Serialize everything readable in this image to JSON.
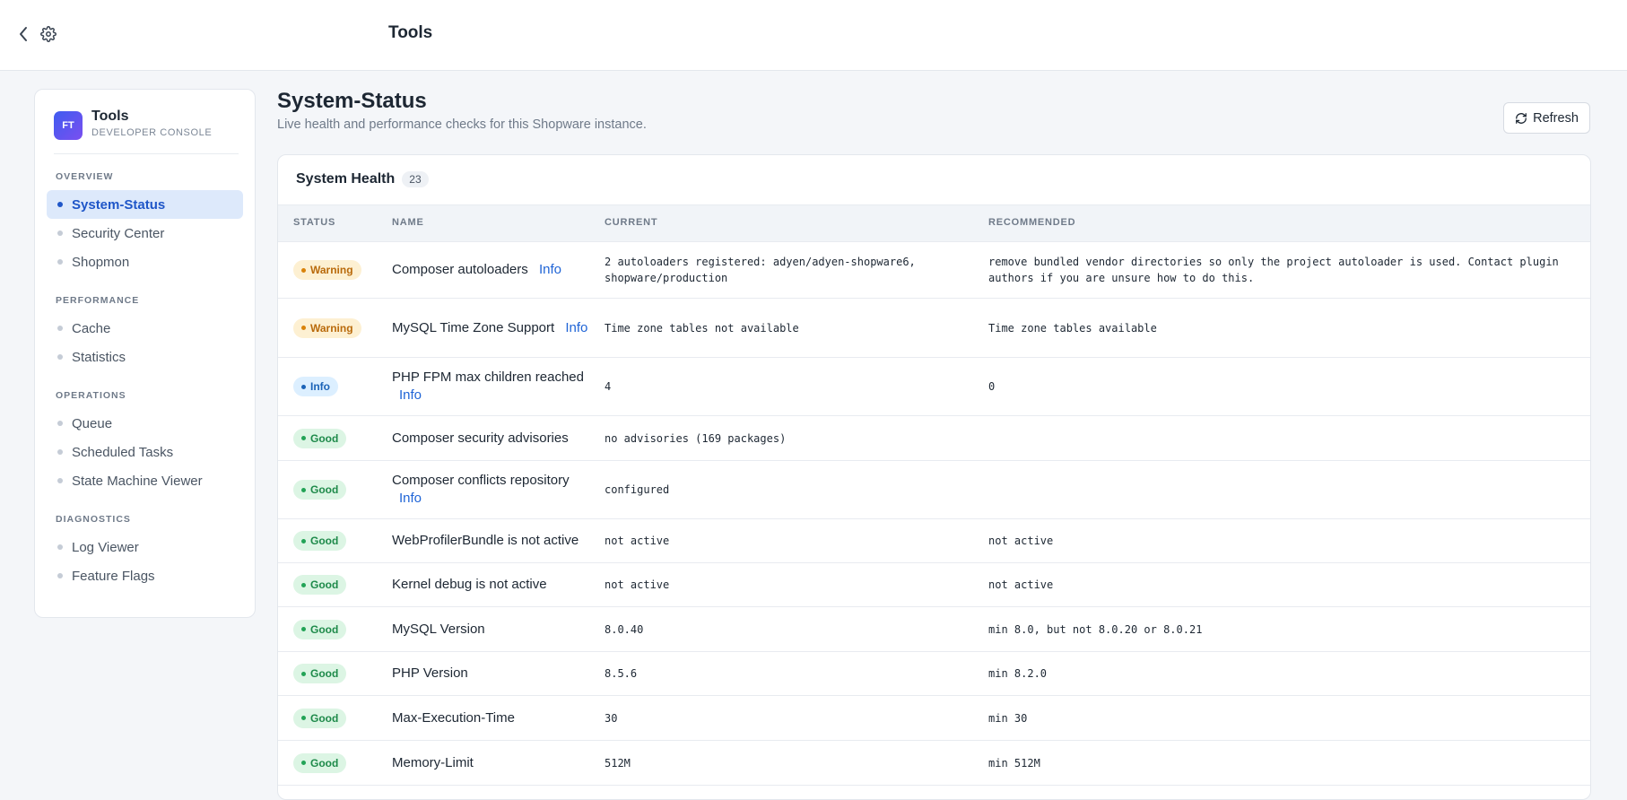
{
  "header": {
    "title": "Tools"
  },
  "sidebar": {
    "brand": {
      "logo": "FT",
      "name": "Tools",
      "subtitle": "DEVELOPER CONSOLE"
    },
    "sections": [
      {
        "label": "OVERVIEW",
        "items": [
          {
            "label": "System-Status",
            "active": true
          },
          {
            "label": "Security Center"
          },
          {
            "label": "Shopmon"
          }
        ]
      },
      {
        "label": "PERFORMANCE",
        "items": [
          {
            "label": "Cache"
          },
          {
            "label": "Statistics"
          }
        ]
      },
      {
        "label": "OPERATIONS",
        "items": [
          {
            "label": "Queue"
          },
          {
            "label": "Scheduled Tasks"
          },
          {
            "label": "State Machine Viewer"
          }
        ]
      },
      {
        "label": "DIAGNOSTICS",
        "items": [
          {
            "label": "Log Viewer"
          },
          {
            "label": "Feature Flags"
          }
        ]
      }
    ]
  },
  "main": {
    "title": "System-Status",
    "subtitle": "Live health and performance checks for this Shopware instance.",
    "refresh_label": "Refresh",
    "card": {
      "title": "System Health",
      "count": "23",
      "columns": [
        "STATUS",
        "NAME",
        "CURRENT",
        "RECOMMENDED"
      ],
      "info_label": "Info",
      "rows": [
        {
          "status": "Warning",
          "name": "Composer autoloaders",
          "info": true,
          "current": "2 autoloaders registered: adyen/adyen-shopware6,\nshopware/production",
          "recommended": "remove bundled vendor directories so only the project autoloader is used. Contact plugin\nauthors if you are unsure how to do this."
        },
        {
          "status": "Warning",
          "name": "MySQL Time Zone Support",
          "info": true,
          "current": "Time zone tables not available",
          "recommended": "Time zone tables available"
        },
        {
          "status": "Info",
          "name": "PHP FPM max children reached",
          "info": true,
          "current": "4",
          "recommended": "0"
        },
        {
          "status": "Good",
          "name": "Composer security advisories",
          "info": false,
          "current": "no advisories (169 packages)",
          "recommended": ""
        },
        {
          "status": "Good",
          "name": "Composer conflicts repository",
          "info": true,
          "current": "configured",
          "recommended": ""
        },
        {
          "status": "Good",
          "name": "WebProfilerBundle is not active",
          "info": false,
          "current": "not active",
          "recommended": "not active"
        },
        {
          "status": "Good",
          "name": "Kernel debug is not active",
          "info": false,
          "current": "not active",
          "recommended": "not active"
        },
        {
          "status": "Good",
          "name": "MySQL Version",
          "info": false,
          "current": "8.0.40",
          "recommended": "min 8.0, but not 8.0.20 or 8.0.21"
        },
        {
          "status": "Good",
          "name": "PHP Version",
          "info": false,
          "current": "8.5.6",
          "recommended": "min 8.2.0"
        },
        {
          "status": "Good",
          "name": "Max-Execution-Time",
          "info": false,
          "current": "30",
          "recommended": "min 30"
        },
        {
          "status": "Good",
          "name": "Memory-Limit",
          "info": false,
          "current": "512M",
          "recommended": "min 512M"
        }
      ]
    }
  },
  "colors": {
    "accent": "#1f56c8",
    "warning": "#b96a0b",
    "info": "#1b63b7",
    "good": "#1e8a4a"
  },
  "icons": {
    "back": "chevron-left-icon",
    "settings": "gear-icon",
    "refresh": "refresh-icon"
  }
}
